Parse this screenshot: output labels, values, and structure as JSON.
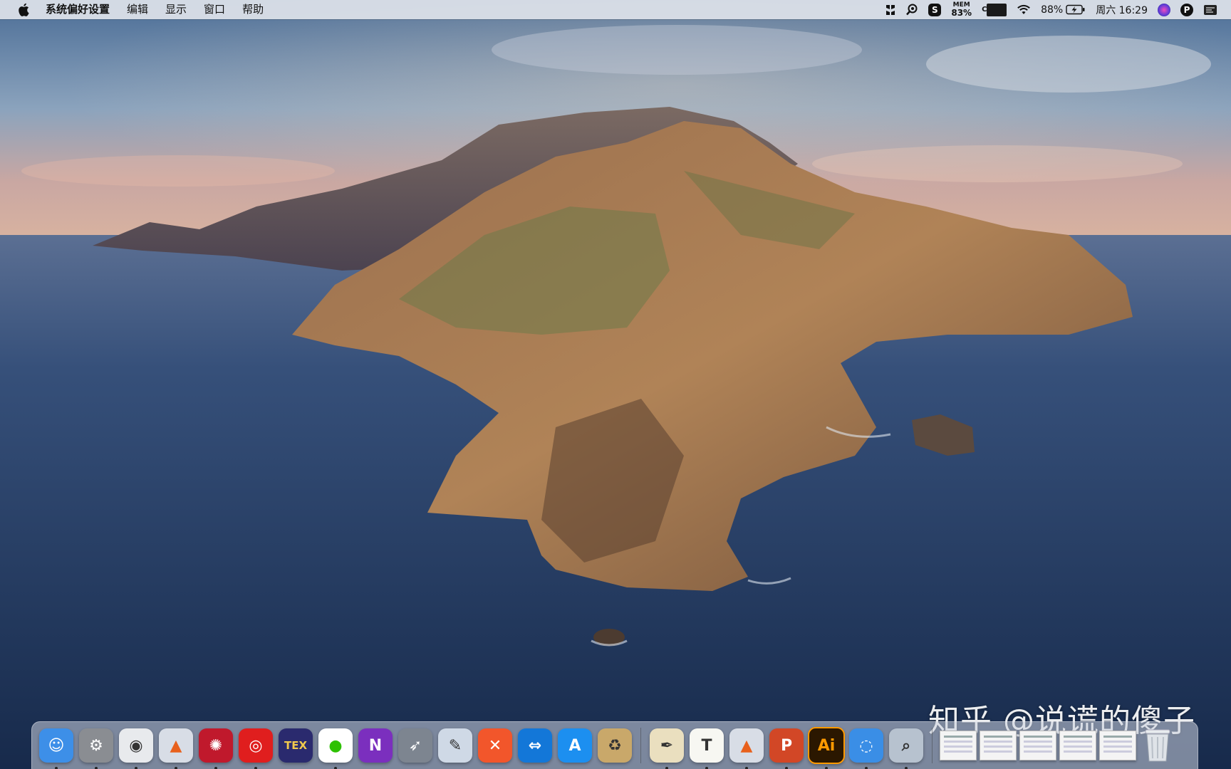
{
  "menubar": {
    "apple_icon": "apple-logo-icon",
    "app_name": "系统偏好设置",
    "menus": [
      "编辑",
      "显示",
      "窗口",
      "帮助"
    ],
    "status": {
      "mem_label": "MEM",
      "mem_value": "83%",
      "battery_percent": "88%",
      "clock": "周六 16:29"
    }
  },
  "dock": {
    "apps": [
      {
        "name": "Finder",
        "icon": "finder-icon",
        "bg": "#3d8fe8",
        "glyph": "☺",
        "running": true
      },
      {
        "name": "系统偏好设置",
        "icon": "system-preferences-icon",
        "bg": "#8a8d92",
        "glyph": "⚙",
        "running": true
      },
      {
        "name": "Google Chrome",
        "icon": "chrome-icon",
        "bg": "#e8eaed",
        "glyph": "◉",
        "running": true
      },
      {
        "name": "MATLAB",
        "icon": "matlab-icon",
        "bg": "#d8dde6",
        "glyph": "▲",
        "running": true
      },
      {
        "name": "Mendeley",
        "icon": "mendeley-icon",
        "bg": "#c0192c",
        "glyph": "✺",
        "running": true
      },
      {
        "name": "网易云音乐",
        "icon": "netease-music-icon",
        "bg": "#e01e1e",
        "glyph": "◎",
        "running": true
      },
      {
        "name": "TeXShop",
        "icon": "texshop-icon",
        "bg": "#2a2a6e",
        "glyph": "TEX",
        "running": false
      },
      {
        "name": "WeChat",
        "icon": "wechat-icon",
        "bg": "#ffffff",
        "glyph": "●",
        "running": true
      },
      {
        "name": "OneNote",
        "icon": "onenote-icon",
        "bg": "#7b2fbe",
        "glyph": "N",
        "running": false
      },
      {
        "name": "Launchpad",
        "icon": "launchpad-icon",
        "bg": "#7d8590",
        "glyph": "➶",
        "running": false
      },
      {
        "name": "Preview",
        "icon": "preview-icon",
        "bg": "#cfd9e6",
        "glyph": "✎",
        "running": false
      },
      {
        "name": "XMind",
        "icon": "xmind-icon",
        "bg": "#f2562b",
        "glyph": "✕",
        "running": false
      },
      {
        "name": "TeamViewer",
        "icon": "teamviewer-icon",
        "bg": "#1377d8",
        "glyph": "⇔",
        "running": false
      },
      {
        "name": "App Store",
        "icon": "app-store-icon",
        "bg": "#1c8ff0",
        "glyph": "A",
        "running": false
      },
      {
        "name": "Archive Utility",
        "icon": "archive-utility-icon",
        "bg": "#c9a86a",
        "glyph": "♻",
        "running": false
      }
    ],
    "apps2": [
      {
        "name": "Script Editor",
        "icon": "script-editor-icon",
        "bg": "#eadfbf",
        "glyph": "✒",
        "running": true
      },
      {
        "name": "TextEdit",
        "icon": "textedit-icon",
        "bg": "#f7f7f2",
        "glyph": "T",
        "running": true
      },
      {
        "name": "MATLAB",
        "icon": "matlab-icon-2",
        "bg": "#d8dde6",
        "glyph": "▲",
        "running": true
      },
      {
        "name": "PowerPoint",
        "icon": "powerpoint-icon",
        "bg": "#d24726",
        "glyph": "P",
        "running": true
      },
      {
        "name": "Illustrator",
        "icon": "illustrator-icon",
        "bg": "#2b1700",
        "glyph": "Ai",
        "running": true
      },
      {
        "name": "Network Utility",
        "icon": "network-utility-icon",
        "bg": "#3a8ee6",
        "glyph": "◌",
        "running": true
      },
      {
        "name": "Image Capture",
        "icon": "image-capture-icon",
        "bg": "#b7c2cf",
        "glyph": "⌕",
        "running": true
      }
    ],
    "minimized_count": 5,
    "trash_icon": "trash-icon"
  },
  "watermark": "知乎 @说谎的傻子"
}
